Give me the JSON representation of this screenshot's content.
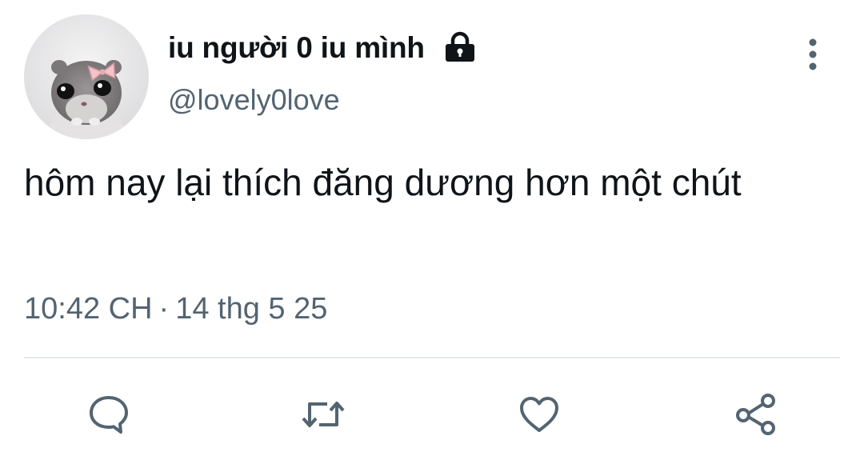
{
  "author": {
    "display_name": "iu người 0 iu mình",
    "handle": "@lovely0love",
    "protected_icon": "lock-icon",
    "avatar": "hamster-avatar"
  },
  "tweet": {
    "text": "hôm nay lại thích đăng dương hơn một chút",
    "time": "10:42 CH",
    "separator": "·",
    "date": "14 thg 5 25"
  },
  "actions": [
    {
      "name": "reply",
      "icon": "comment-icon"
    },
    {
      "name": "retweet",
      "icon": "retweet-icon"
    },
    {
      "name": "like",
      "icon": "heart-icon"
    },
    {
      "name": "share",
      "icon": "share-icon"
    }
  ],
  "colors": {
    "text_primary": "#0f1419",
    "text_secondary": "#536471",
    "divider": "#e6e9ec",
    "icon": "#536471"
  }
}
